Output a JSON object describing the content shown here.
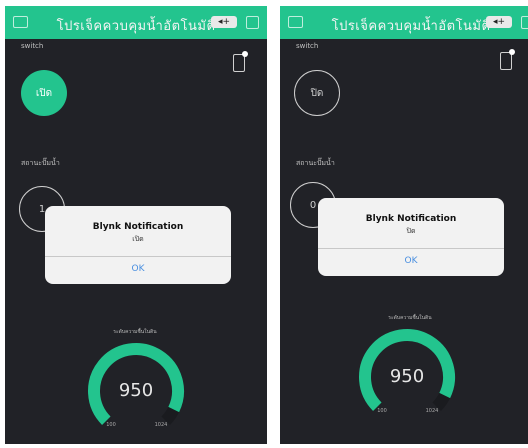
{
  "app": {
    "title": "โปรเจ็คควบคุมน้ำอัตโนมัติ",
    "badge": "◂+"
  },
  "colors": {
    "accent": "#23c48e",
    "background": "#212227"
  },
  "screens": [
    {
      "switch_label": "switch",
      "button_state": "เปิด",
      "second_label": "สถานะปั๊มน้ำ",
      "second_value": "1",
      "dialog": {
        "title": "Blynk Notification",
        "message": "เปิด",
        "ok": "OK"
      },
      "gauge": {
        "label": "ระดับความชื้นในดิน",
        "value": "950",
        "min": "100",
        "max": "1024",
        "level": 0.93
      }
    },
    {
      "switch_label": "switch",
      "button_state": "ปิด",
      "second_label": "สถานะปั๊มน้ำ",
      "second_value": "0",
      "dialog": {
        "title": "Blynk Notification",
        "message": "ปิด",
        "ok": "OK"
      },
      "gauge": {
        "label": "ระดับความชื้นในดิน",
        "value": "950",
        "min": "100",
        "max": "1024",
        "level": 0.93
      }
    }
  ]
}
